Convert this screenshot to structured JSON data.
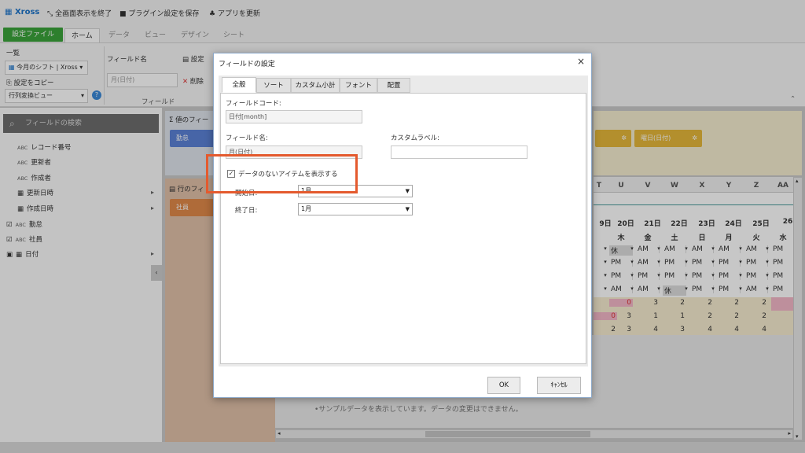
{
  "titlebar": {
    "app_name": "Xross",
    "exit_fullscreen": "全画面表示を終了",
    "save_plugin": "プラグイン設定を保存",
    "update_app": "アプリを更新"
  },
  "ribbon_tabs": [
    "設定ファイル",
    "ホーム",
    "データ",
    "ビュー",
    "デザイン",
    "シート"
  ],
  "ribbon": {
    "list_label": "一覧",
    "list_value": "今月のシフト | Xross",
    "copy_settings": "設定をコピー",
    "view_select": "行列変換ビュー",
    "field_name_label": "フィールド名",
    "field_name_value": "月(日付)",
    "settings_btn": "設定",
    "delete_btn": "削除",
    "group_label": "フィールド"
  },
  "left_panel": {
    "search_placeholder": "フィールドの検索",
    "fields": [
      {
        "type": "ABC",
        "label": "レコード番号"
      },
      {
        "type": "ABC",
        "label": "更新者"
      },
      {
        "type": "ABC",
        "label": "作成者"
      },
      {
        "type": "date",
        "label": "更新日時"
      },
      {
        "type": "date",
        "label": "作成日時"
      },
      {
        "type": "ABC",
        "label": "勤怠"
      },
      {
        "type": "ABC",
        "label": "社員"
      },
      {
        "type": "date",
        "label": "日付"
      }
    ]
  },
  "value_panel": {
    "title": "値のフィー",
    "chip": "勤怠"
  },
  "row_panel": {
    "title": "行のフィ",
    "chip": "社員"
  },
  "right_panel": {
    "chip": "曜日(日付)"
  },
  "grid": {
    "columns": [
      "U",
      "V",
      "W",
      "X",
      "Y",
      "Z",
      "AA"
    ],
    "dates": [
      "9日",
      "20日",
      "21日",
      "22日",
      "23日",
      "24日",
      "25日",
      "26"
    ],
    "weekdays": [
      "木",
      "金",
      "土",
      "日",
      "月",
      "火",
      "水"
    ],
    "rows": [
      [
        "休",
        "AM",
        "AM",
        "AM",
        "AM",
        "AM",
        "PM"
      ],
      [
        "PM",
        "AM",
        "PM",
        "PM",
        "PM",
        "PM",
        "PM"
      ],
      [
        "PM",
        "PM",
        "PM",
        "PM",
        "PM",
        "PM",
        "PM"
      ],
      [
        "AM",
        "AM",
        "休",
        "PM",
        "PM",
        "AM",
        "PM"
      ]
    ],
    "counts": [
      [
        "2",
        "0",
        "3",
        "2",
        "2",
        "2",
        "2"
      ],
      [
        "0",
        "3",
        "1",
        "1",
        "2",
        "2",
        "2"
      ],
      [
        "2",
        "3",
        "4",
        "3",
        "4",
        "4",
        "4"
      ]
    ],
    "note": "•サンプルデータを表示しています。データの変更はできません。"
  },
  "dialog": {
    "title": "フィールドの設定",
    "close": "×",
    "tabs": [
      "全般",
      "ソート",
      "カスタム小計",
      "フォント",
      "配置"
    ],
    "field_code_label": "フィールドコード:",
    "field_code_value": "日付[month]",
    "field_name_label": "フィールド名:",
    "field_name_value": "月(日付)",
    "custom_label_label": "カスタムラベル:",
    "custom_label_value": "",
    "show_empty_label": "データのないアイテムを表示する",
    "show_empty_checked": "✓",
    "start_label": "開始日:",
    "start_value": "1月",
    "end_label": "終了日:",
    "end_value": "1月",
    "ok": "OK",
    "cancel": "ｷｬﾝｾﾙ"
  },
  "colors": {
    "file_tab": "#3aa33a",
    "value_chip": "#5b82d6",
    "row_chip": "#e0894a",
    "yellow_chip": "#e6b83a",
    "highlight": "#e45a2e",
    "pink": "#f4b8c8"
  }
}
